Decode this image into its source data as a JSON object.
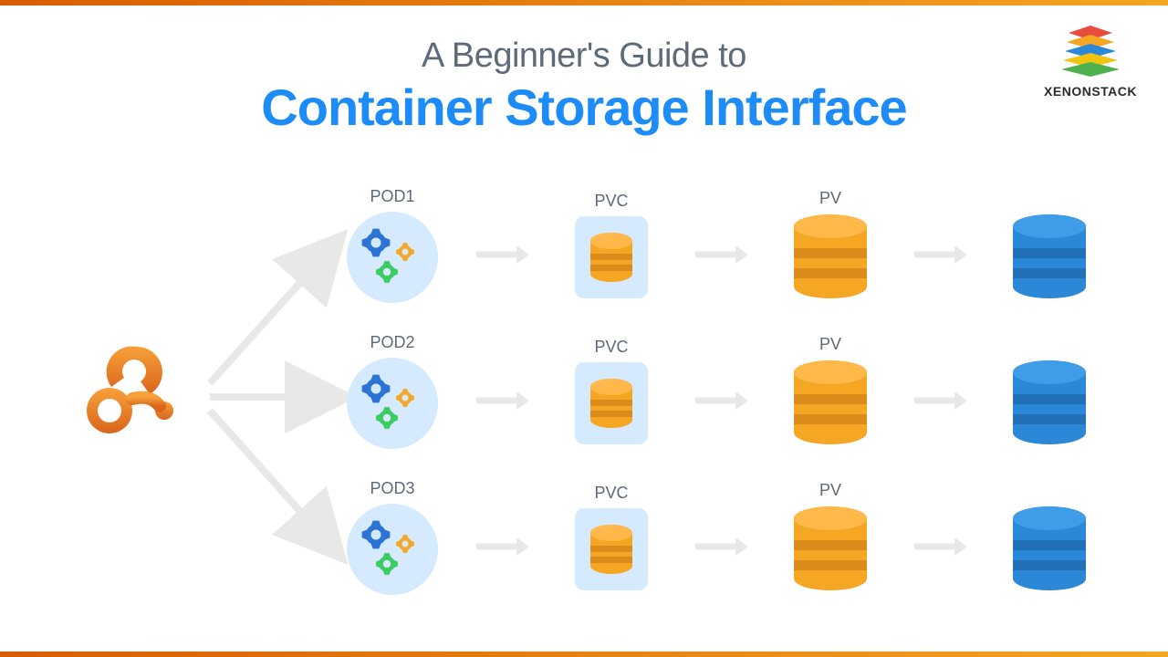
{
  "brand": {
    "name": "XENONSTACK"
  },
  "header": {
    "subtitle": "A Beginner's Guide to",
    "title": "Container Storage Interface"
  },
  "rows": [
    {
      "pod": "POD1",
      "pvc": "PVC",
      "pv": "PV"
    },
    {
      "pod": "POD2",
      "pvc": "PVC",
      "pv": "PV"
    },
    {
      "pod": "POD3",
      "pvc": "PVC",
      "pv": "PV"
    }
  ],
  "colors": {
    "accent_orange": "#f5a623",
    "accent_blue": "#1d8cf8",
    "arrow": "#e8e8e8",
    "label": "#5e6a78"
  }
}
